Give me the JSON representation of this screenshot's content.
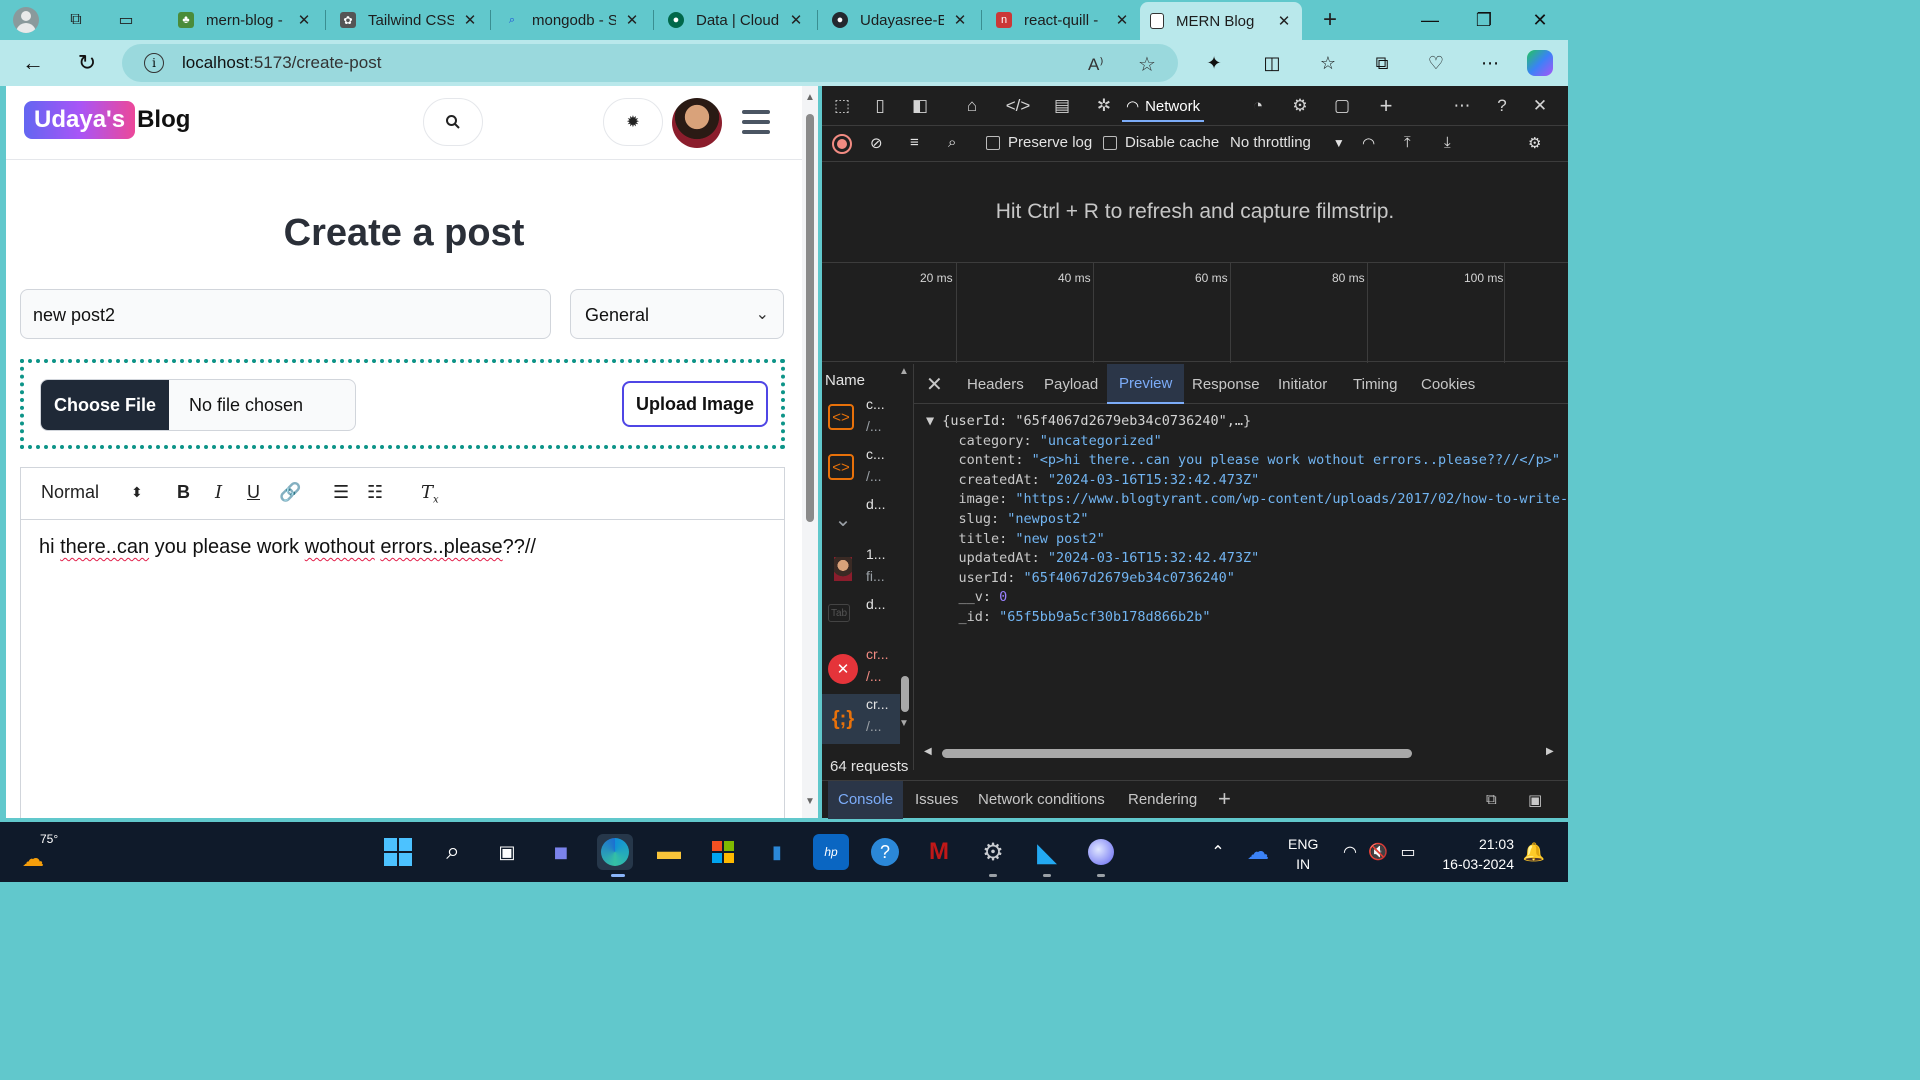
{
  "browser": {
    "tabs": [
      {
        "title": "mern-blog -",
        "fav_color": "#4a8c3a",
        "icon": "leaf-icon"
      },
      {
        "title": "Tailwind CSS",
        "fav_color": "#38bdf8",
        "icon": "openai-icon"
      },
      {
        "title": "mongodb - S",
        "fav_color": "#3b82f6",
        "icon": "search-icon"
      },
      {
        "title": "Data | Cloud",
        "fav_color": "#00684a",
        "icon": "mongodb-leaf-icon"
      },
      {
        "title": "Udayasree-B",
        "fav_color": "#24292f",
        "icon": "github-icon"
      },
      {
        "title": "react-quill -",
        "fav_color": "#cb3837",
        "icon": "npm-icon"
      },
      {
        "title": "MERN Blog",
        "fav_color": "#ffffff",
        "icon": "page-icon"
      }
    ],
    "address": {
      "host": "localhost",
      "path": ":5173/create-post"
    }
  },
  "page": {
    "logo": {
      "badge": "Udaya's",
      "rest": "Blog"
    },
    "title": "Create a post",
    "title_input": "new post2",
    "category": "General",
    "choose_file": "Choose File",
    "no_file": "No file chosen",
    "upload_button": "Upload Image",
    "toolbar": {
      "format": "Normal"
    },
    "editor_text": {
      "t1": "hi ",
      "t2": "there..can",
      "t3": " you please work ",
      "t4": "wothout",
      "t5": " ",
      "t6": "errors..please",
      "t7": "??//"
    }
  },
  "devtools": {
    "active_tab": "Network",
    "preserve_log": "Preserve log",
    "disable_cache": "Disable cache",
    "throttling": "No throttling",
    "filmstrip_msg": "Hit Ctrl + R to refresh and capture filmstrip.",
    "ticks": [
      "20 ms",
      "40 ms",
      "60 ms",
      "80 ms",
      "100 ms"
    ],
    "name_header": "Name",
    "requests": [
      {
        "n1": "c...",
        "n2": "/..."
      },
      {
        "n1": "c...",
        "n2": "/..."
      },
      {
        "n1": "d...",
        "n2": ""
      },
      {
        "n1": "1...",
        "n2": "fi..."
      },
      {
        "n1": "d...",
        "n2": ""
      },
      {
        "n1": "cr...",
        "n2": "/..."
      },
      {
        "n1": "cr...",
        "n2": "/..."
      }
    ],
    "request_count": "64 requests",
    "detail_tabs": [
      "Headers",
      "Payload",
      "Preview",
      "Response",
      "Initiator",
      "Timing",
      "Cookies"
    ],
    "detail_active": "Preview",
    "preview": {
      "summary": "{userId: \"65f4067d2679eb34c0736240\",…}",
      "category": "\"uncategorized\"",
      "content": "\"<p>hi there..can you please work wothout errors..please??//</p>\"",
      "createdAt": "\"2024-03-16T15:32:42.473Z\"",
      "image": "\"https://www.blogtyrant.com/wp-content/uploads/2017/02/how-to-write-",
      "slug": "\"newpost2\"",
      "title": "\"new post2\"",
      "updatedAt": "\"2024-03-16T15:32:42.473Z\"",
      "userId": "\"65f4067d2679eb34c0736240\"",
      "__v": "0",
      "_id": "\"65f5bb9a5cf30b178d866b2b\""
    },
    "drawer_tabs": [
      "Console",
      "Issues",
      "Network conditions",
      "Rendering"
    ]
  },
  "taskbar": {
    "temp": "75°",
    "lang1": "ENG",
    "lang2": "IN",
    "time": "21:03",
    "date": "16-03-2024"
  }
}
